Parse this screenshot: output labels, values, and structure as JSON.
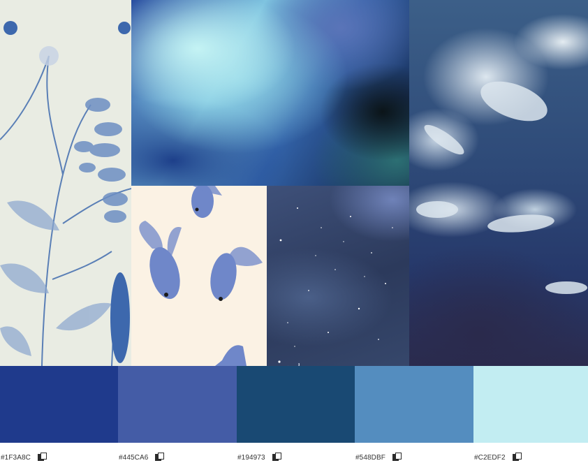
{
  "images": [
    {
      "id": "botanical",
      "description_icon": "botanical-cyanotype-image"
    },
    {
      "id": "blur",
      "description_icon": "abstract-blur-image"
    },
    {
      "id": "fish",
      "description_icon": "fish-illustration-image"
    },
    {
      "id": "sky",
      "description_icon": "night-sky-image"
    },
    {
      "id": "water",
      "description_icon": "underwater-fish-image"
    }
  ],
  "palette": {
    "swatches": [
      {
        "hex": "#1F3A8C",
        "label": "#1F3A8C"
      },
      {
        "hex": "#445CA6",
        "label": "#445CA6"
      },
      {
        "hex": "#194973",
        "label": "#194973"
      },
      {
        "hex": "#548DBF",
        "label": "#548DBF"
      },
      {
        "hex": "#C2EDF2",
        "label": "#C2EDF2"
      }
    ],
    "copy_icon": "copy-icon"
  }
}
